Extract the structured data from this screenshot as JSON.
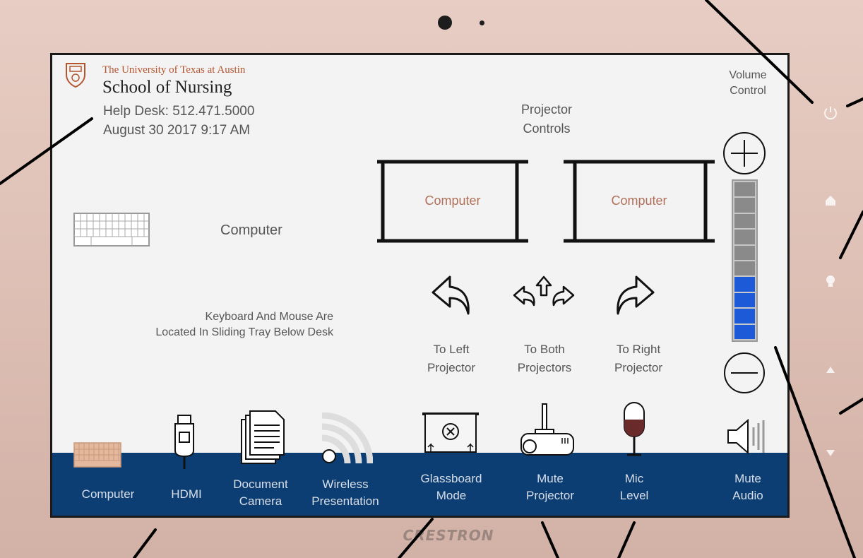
{
  "header": {
    "university": "The University of Texas at Austin",
    "school": "School of Nursing",
    "helpdesk": "Help Desk: 512.471.5000",
    "datetime": "August 30 2017 9:17 AM"
  },
  "main": {
    "current_source": "Computer",
    "note_line1": "Keyboard And Mouse Are",
    "note_line2": "Located In Sliding Tray Below Desk"
  },
  "projectors": {
    "title_line1": "Projector",
    "title_line2": "Controls",
    "left_screen_label": "Computer",
    "right_screen_label": "Computer",
    "to_left_line1": "To Left",
    "to_left_line2": "Projector",
    "to_both_line1": "To Both",
    "to_both_line2": "Projectors",
    "to_right_line1": "To Right",
    "to_right_line2": "Projector"
  },
  "volume": {
    "title_line1": "Volume",
    "title_line2": "Control",
    "level": 0.4,
    "segments_total": 10,
    "segments_on": 4,
    "accent": "#1d5ad8"
  },
  "bottom_nav": {
    "computer": "Computer",
    "hdmi": "HDMI",
    "document_camera_line1": "Document",
    "document_camera_line2": "Camera",
    "wireless_line1": "Wireless",
    "wireless_line2": "Presentation",
    "glassboard_line1": "Glassboard",
    "glassboard_line2": "Mode",
    "mute_projector_line1": "Mute",
    "mute_projector_line2": "Projector",
    "mic_level_line1": "Mic",
    "mic_level_line2": "Level",
    "mute_audio_line1": "Mute",
    "mute_audio_line2": "Audio"
  },
  "device": {
    "brand": "CRESTRON"
  },
  "colors": {
    "bar": "#0c3d73",
    "accent_orange": "#b5542d",
    "volume_on": "#1d5ad8"
  },
  "icons": [
    "ut-seal-icon",
    "keyboard-icon",
    "left-arrow-icon",
    "both-arrows-icon",
    "right-arrow-icon",
    "plus-icon",
    "minus-icon",
    "hdmi-icon",
    "document-icon",
    "wireless-icon",
    "glassboard-icon",
    "projector-icon",
    "microphone-icon",
    "speaker-icon",
    "power-icon",
    "home-icon",
    "lightbulb-icon",
    "up-icon",
    "down-icon"
  ]
}
